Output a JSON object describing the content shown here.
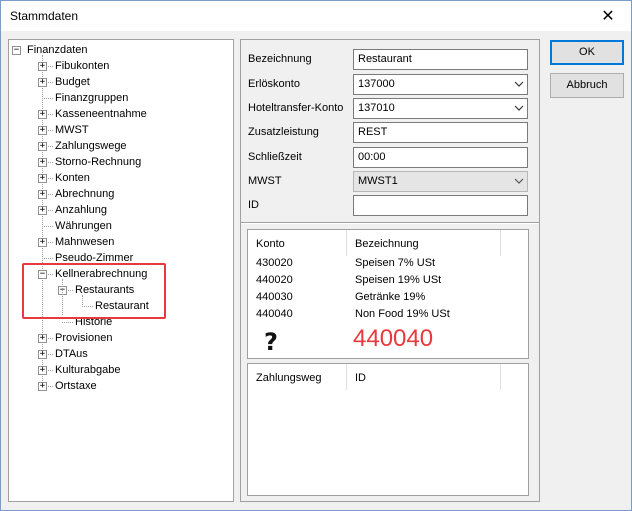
{
  "window": {
    "title": "Stammdaten",
    "close_symbol": "✕"
  },
  "tree": {
    "root": "Finanzdaten",
    "items": [
      {
        "label": "Fibukonten",
        "expander": "+"
      },
      {
        "label": "Budget",
        "expander": "+"
      },
      {
        "label": "Finanzgruppen",
        "expander": ""
      },
      {
        "label": "Kasseneentnahme",
        "expander": "+"
      },
      {
        "label": "MWST",
        "expander": "+"
      },
      {
        "label": "Zahlungswege",
        "expander": "+"
      },
      {
        "label": "Storno-Rechnung",
        "expander": "+"
      },
      {
        "label": "Konten",
        "expander": "+"
      },
      {
        "label": "Abrechnung",
        "expander": "+"
      },
      {
        "label": "Anzahlung",
        "expander": "+"
      },
      {
        "label": "Währungen",
        "expander": ""
      },
      {
        "label": "Mahnwesen",
        "expander": "+"
      },
      {
        "label": "Pseudo-Zimmer",
        "expander": ""
      },
      {
        "label": "Kellnerabrechnung",
        "expander": "−"
      },
      {
        "label": "Restaurants",
        "expander": "−"
      },
      {
        "label": "Restaurant",
        "expander": ""
      },
      {
        "label": "Historie",
        "expander": ""
      },
      {
        "label": "Provisionen",
        "expander": "+"
      },
      {
        "label": "DTAus",
        "expander": "+"
      },
      {
        "label": "Kulturabgabe",
        "expander": "+"
      },
      {
        "label": "Ortstaxe",
        "expander": "+"
      }
    ]
  },
  "form": {
    "bezeichnung_label": "Bezeichnung",
    "bezeichnung_value": "Restaurant",
    "erloeskonto_label": "Erlöskonto",
    "erloeskonto_value": "137000",
    "hoteltransfer_label": "Hoteltransfer-Konto",
    "hoteltransfer_value": "137010",
    "zusatzleistung_label": "Zusatzleistung",
    "zusatzleistung_value": "REST",
    "schliesszeit_label": "Schließzeit",
    "schliesszeit_value": "00:00",
    "mwst_label": "MWST",
    "mwst_value": "MWST1",
    "id_label": "ID",
    "id_value": ""
  },
  "konto_list": {
    "headers": [
      "Konto",
      "Bezeichnung"
    ],
    "rows": [
      {
        "konto": "430020",
        "bezeichnung": "Speisen 7% USt"
      },
      {
        "konto": "440020",
        "bezeichnung": "Speisen 19% USt"
      },
      {
        "konto": "440030",
        "bezeichnung": "Getränke 19%"
      },
      {
        "konto": "440040",
        "bezeichnung": "Non Food 19% USt"
      }
    ]
  },
  "zahl_list": {
    "headers": [
      "Zahlungsweg",
      "ID"
    ]
  },
  "annotation": {
    "question": "?",
    "number": "440040",
    "color": "#e8393d"
  },
  "buttons": {
    "ok": "OK",
    "abbruch": "Abbruch"
  }
}
